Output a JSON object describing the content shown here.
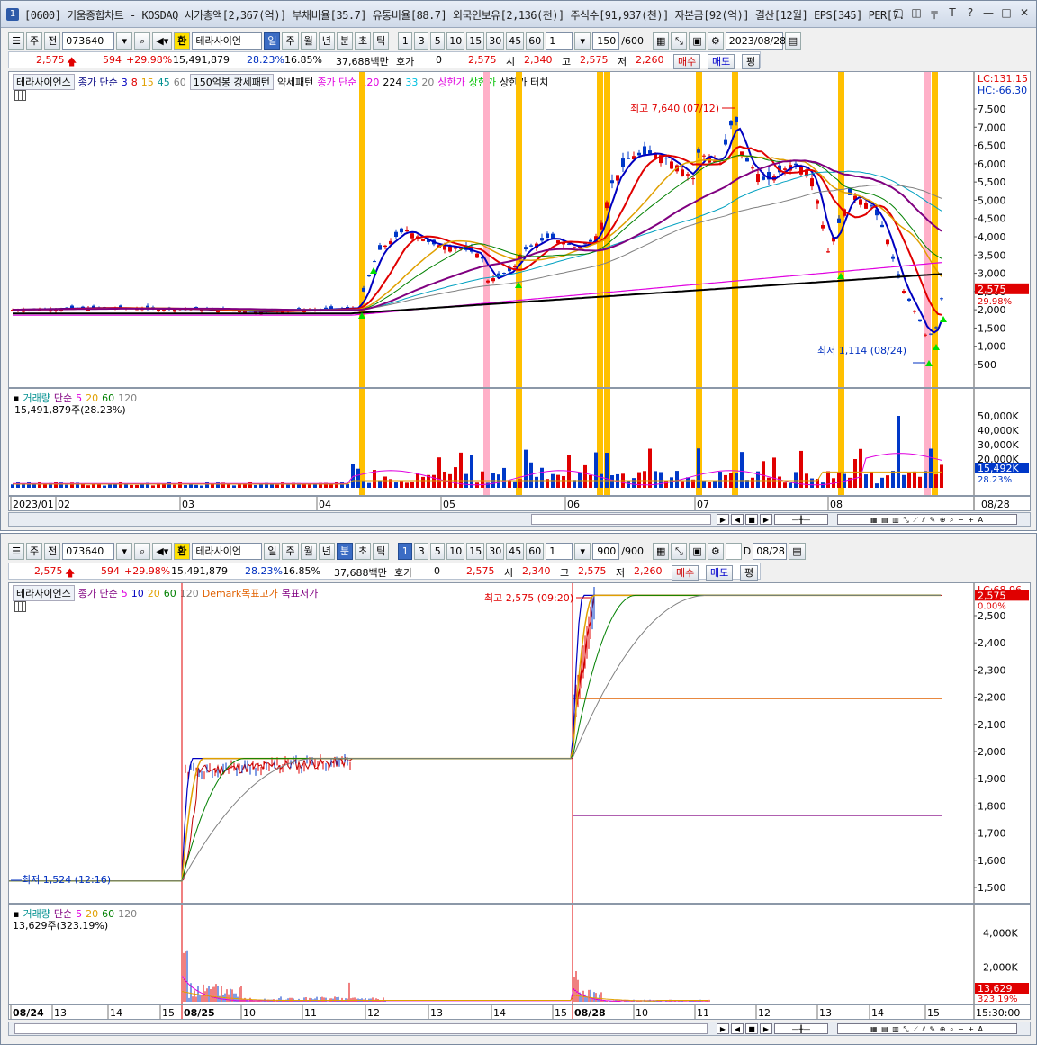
{
  "window1": {
    "title": "[0600] 키움종합차트 - KOSDAQ 시가총액[2,367(억)] 부채비율[35.7] 유통비율[88.7] 외국인보유[2,136(천)] 주식수[91,937(천)] 자본금[92(억)] 결산[12월] EPS[345] PER[7.",
    "winno": "1",
    "toolbar": {
      "type": "주",
      "prev": "전",
      "code": "073640",
      "fx": "환",
      "name": "테라사이언",
      "periods": [
        "일",
        "주",
        "월",
        "년",
        "분",
        "초",
        "틱"
      ],
      "nums": [
        "1",
        "3",
        "5",
        "10",
        "15",
        "30",
        "45",
        "60"
      ],
      "unit": "1",
      "count": "150",
      "total": "/600",
      "date": "2023/08/28"
    },
    "quote": {
      "price": "2,575",
      "change": "594",
      "rate": "+29.98%",
      "volume": "15,491,879",
      "vol_rate": "28.23%",
      "turnover": "16.85%",
      "amount": "37,688백만",
      "hoga_label": "호가",
      "hoga": "0",
      "cur": "2,575",
      "open_label": "시",
      "open": "2,340",
      "high_label": "고",
      "high": "2,575",
      "low_label": "저",
      "low": "2,260",
      "buy": "매수",
      "sell": "매도",
      "avg": "평"
    },
    "legend": {
      "name": "테라사이언스",
      "ma_label": "종가 단순",
      "ma": [
        "3",
        "8",
        "15",
        "45",
        "60"
      ],
      "pattern": "150억봉 강세패턴",
      "weak": "약세패턴",
      "ma2_label": "종가 단순",
      "ma2": [
        "120",
        "224",
        "33",
        "20"
      ],
      "limit1": "상한가",
      "limit2": "상한가",
      "limit3": "상한가 터치"
    },
    "price_axis": [
      "7,500",
      "7,000",
      "6,500",
      "6,000",
      "5,500",
      "5,000",
      "4,500",
      "4,000",
      "3,500",
      "3,000",
      "2,500",
      "2,000",
      "1,500",
      "1,000",
      "500"
    ],
    "lc": "LC:131.15",
    "hc": "HC:-66.30",
    "cur_box": "2,575",
    "cur_pct": "29.98%",
    "high_note": "최고 7,640 (07/12)",
    "low_note": "최저 1,114 (08/24)",
    "vol_legend": {
      "label": "거래량",
      "ma_label": "단순",
      "ma": [
        "5",
        "20",
        "60",
        "120"
      ],
      "value": "15,491,879주(28.23%)"
    },
    "vol_axis": [
      "50,000K",
      "40,000K",
      "30,000K",
      "20,000K"
    ],
    "vol_box": "15,492K",
    "vol_pct": "28.23%",
    "x_labels": [
      "2023/01",
      "02",
      "03",
      "04",
      "05",
      "06",
      "07",
      "08"
    ],
    "x_right": "08/28"
  },
  "window2": {
    "toolbar": {
      "type": "주",
      "prev": "전",
      "code": "073640",
      "fx": "환",
      "name": "테라사이언",
      "periods": [
        "일",
        "주",
        "월",
        "년",
        "분",
        "초",
        "틱"
      ],
      "nums": [
        "1",
        "3",
        "5",
        "10",
        "15",
        "30",
        "45",
        "60"
      ],
      "unit": "1",
      "count": "900",
      "total": "/900",
      "d_label": "D",
      "date": "08/28"
    },
    "quote": {
      "price": "2,575",
      "change": "594",
      "rate": "+29.98%",
      "volume": "15,491,879",
      "vol_rate": "28.23%",
      "turnover": "16.85%",
      "amount": "37,688백만",
      "hoga_label": "호가",
      "hoga": "0",
      "cur": "2,575",
      "open_label": "시",
      "open": "2,340",
      "high_label": "고",
      "high": "2,575",
      "low_label": "저",
      "low": "2,260",
      "buy": "매수",
      "sell": "매도",
      "avg": "평"
    },
    "legend": {
      "name": "테라사이언스",
      "ma_label": "종가 단순",
      "ma": [
        "5",
        "10",
        "20",
        "60",
        "120"
      ],
      "demark": "Demark목표고가",
      "demark_low": "목표저가"
    },
    "price_axis": [
      "2,500",
      "2,400",
      "2,300",
      "2,200",
      "2,100",
      "2,000",
      "1,900",
      "1,800",
      "1,700",
      "1,600",
      "1,500"
    ],
    "lc": "LC:68.96",
    "cur_box": "2,575",
    "cur_pct": "0.00%",
    "high_note": "최고 2,575 (09:20)",
    "low_note": "최저 1,524 (12:16)",
    "vol_legend": {
      "label": "거래량",
      "ma_label": "단순",
      "ma": [
        "5",
        "20",
        "60",
        "120"
      ],
      "value": "13,629주(323.19%)"
    },
    "vol_axis": [
      "4,000K",
      "2,000K"
    ],
    "vol_box": "13,629",
    "vol_pct": "323.19%",
    "x_labels": [
      "08/24",
      "13",
      "14",
      "15",
      "08/25",
      "10",
      "11",
      "12",
      "13",
      "14",
      "15",
      "08/28",
      "10",
      "11",
      "12",
      "13",
      "14",
      "15"
    ],
    "x_right": "15:30:00"
  },
  "colors": {
    "up": "#e00000",
    "down": "#0038c8",
    "limit_bar": "#ffc000",
    "touch_bar": "#ffb0c8",
    "ma_black": "#000000"
  }
}
